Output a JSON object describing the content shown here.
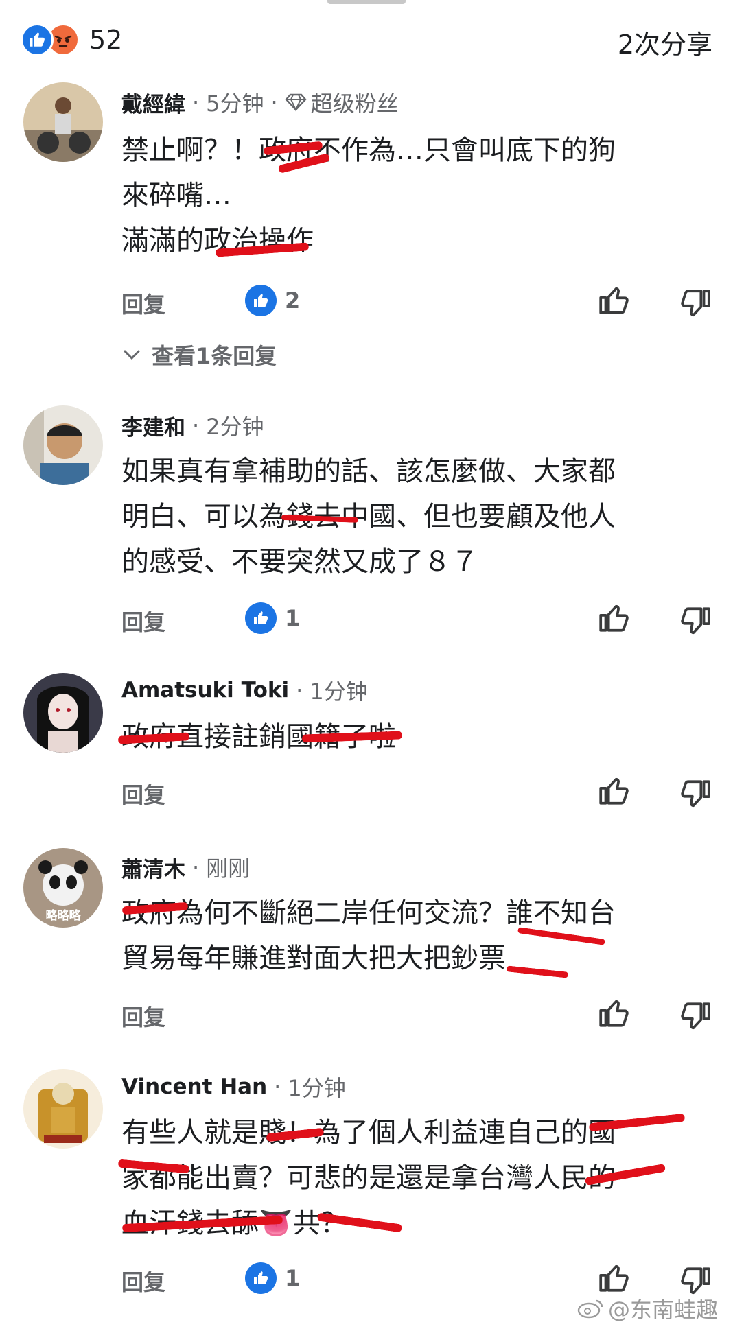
{
  "reactions": {
    "count": "52",
    "shares": "2次分享",
    "like_color": "#1b74e4",
    "angry_color": "#f06a3c"
  },
  "comments": [
    {
      "author": "戴經緯",
      "time": "5分钟",
      "badge": "超级粉丝",
      "lines": [
        "禁止啊？！政府不作為…只會叫底下的狗",
        "來碎嘴…",
        "滿滿的政治操作"
      ],
      "reply_label": "回复",
      "likes": "2",
      "view_replies": "查看1条回复"
    },
    {
      "author": "李建和",
      "time": "2分钟",
      "lines": [
        "如果真有拿補助的話、該怎麼做、大家都",
        "明白、可以為錢去中國、但也要顧及他人",
        "的感受、不要突然又成了８７"
      ],
      "reply_label": "回复",
      "likes": "1"
    },
    {
      "author": "Amatsuki Toki",
      "time": "1分钟",
      "lines": [
        "政府直接註銷國籍了啦"
      ],
      "reply_label": "回复"
    },
    {
      "author": "蕭清木",
      "time": "刚刚",
      "avatar_text": "略略略",
      "lines": [
        "政府為何不斷絕二岸任何交流？誰不知台",
        "貿易每年賺進對面大把大把鈔票"
      ],
      "reply_label": "回复"
    },
    {
      "author": "Vincent Han",
      "time": "1分钟",
      "lines": [
        "有些人就是賤！為了個人利益連自己的國",
        "家都能出賣？可悲的是還是拿台灣人民的",
        "血汗錢去舔👅共？"
      ],
      "reply_label": "回复",
      "likes": "1"
    }
  ],
  "icons": [
    "like-icon",
    "angry-icon",
    "diamond-icon",
    "thumbs-up-icon",
    "thumbs-down-icon",
    "chevron-down-icon",
    "weibo-icon"
  ],
  "watermark": "@东南蛙趣"
}
